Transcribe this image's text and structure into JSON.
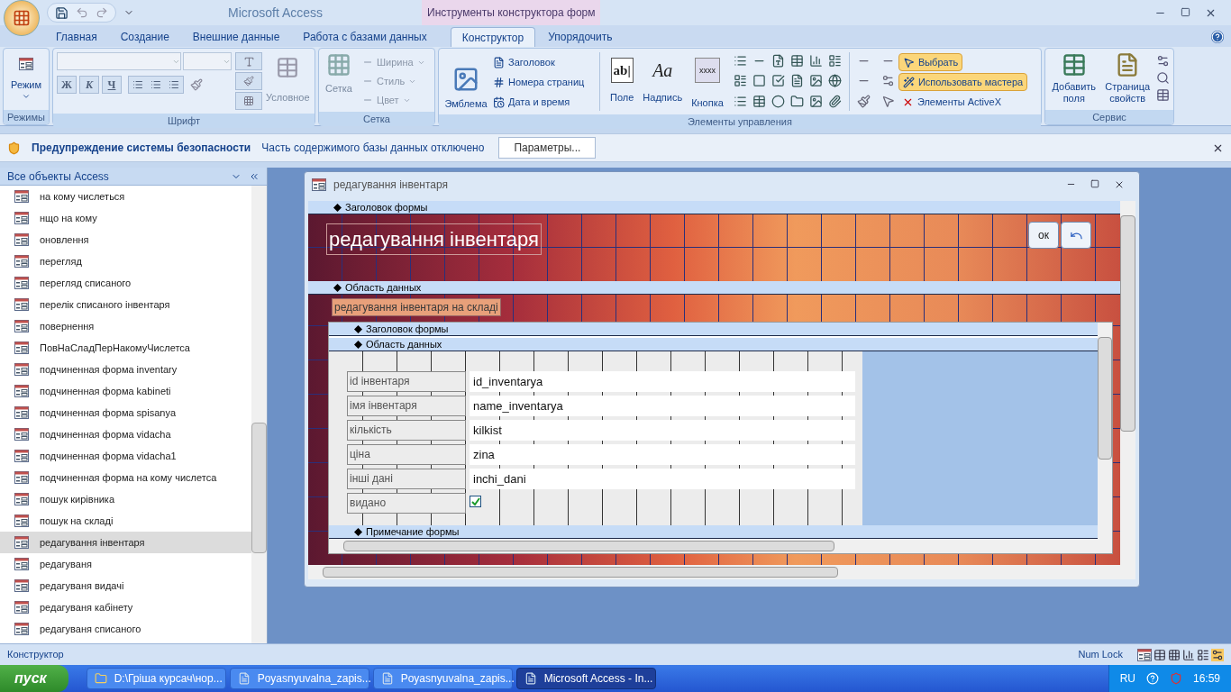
{
  "window": {
    "title": "Microsoft Access",
    "context_tab": "Инструменты конструктора форм"
  },
  "ribbon_tabs": [
    {
      "label": "Главная",
      "selected": false
    },
    {
      "label": "Создание",
      "selected": false
    },
    {
      "label": "Внешние данные",
      "selected": false
    },
    {
      "label": "Работа с базами данных",
      "selected": false
    },
    {
      "label": "Конструктор",
      "selected": true
    },
    {
      "label": "Упорядочить",
      "selected": false
    }
  ],
  "ribbon": {
    "modes": {
      "label": "Режимы",
      "button": "Режим"
    },
    "font": {
      "label": "Шрифт",
      "styles": [
        "Ж",
        "К",
        "Ч"
      ],
      "conditional": "Условное"
    },
    "grid": {
      "label": "Сетка",
      "button": "Сетка",
      "items": [
        "Ширина",
        "Стиль",
        "Цвет"
      ]
    },
    "controls": {
      "label": "Элементы управления",
      "logo": "Эмблема",
      "header_items": [
        "Заголовок",
        "Номера страниц",
        "Дата и время"
      ],
      "big_buttons": [
        {
          "label": "Поле",
          "glyph": "ab|"
        },
        {
          "label": "Надпись",
          "glyph": "Aa"
        },
        {
          "label": "Кнопка",
          "glyph": "xxxx"
        }
      ],
      "select": {
        "label": "Выбрать",
        "selected": true
      },
      "wizard": {
        "label": "Использовать мастера",
        "on": true
      },
      "activex": "Элементы ActiveX"
    },
    "service": {
      "label": "Сервис",
      "buttons": [
        "Добавить поля",
        "Страница свойств"
      ]
    }
  },
  "security_bar": {
    "title": "Предупреждение системы безопасности",
    "message": "Часть содержимого базы данных отключено",
    "button": "Параметры..."
  },
  "nav": {
    "title": "Все объекты Access",
    "items": [
      {
        "label": "на кому числеться",
        "selected": false
      },
      {
        "label": "нщо на кому",
        "selected": false
      },
      {
        "label": "оновлення",
        "selected": false
      },
      {
        "label": "перегляд",
        "selected": false
      },
      {
        "label": "перегляд списаного",
        "selected": false
      },
      {
        "label": "перелік списаного інвентаря",
        "selected": false
      },
      {
        "label": "повернення",
        "selected": false
      },
      {
        "label": "ПовНаСладПерНакомуЧислетса",
        "selected": false
      },
      {
        "label": "подчиненная форма inventary",
        "selected": false
      },
      {
        "label": "подчиненная форма kabineti",
        "selected": false
      },
      {
        "label": "подчиненная форма spisanya",
        "selected": false
      },
      {
        "label": "подчиненная форма vidacha",
        "selected": false
      },
      {
        "label": "подчиненная форма vidacha1",
        "selected": false
      },
      {
        "label": "подчиненная форма на кому числетса",
        "selected": false
      },
      {
        "label": "пошук кирівника",
        "selected": false
      },
      {
        "label": "пошук на складі",
        "selected": false
      },
      {
        "label": "редагування інвентаря",
        "selected": true
      },
      {
        "label": "редагуваня",
        "selected": false
      },
      {
        "label": "редагуваня видачі",
        "selected": false
      },
      {
        "label": "редагуваня кабінету",
        "selected": false
      },
      {
        "label": "редагуваня списаного",
        "selected": false
      }
    ]
  },
  "form_window": {
    "title": "редагування інвентаря",
    "header_section": "Заголовок формы",
    "detail_section": "Область данных",
    "heading": "редагування інвентаря",
    "ok_button": "ок",
    "detail_label": "редагування інвентаря на складі",
    "subform": {
      "header_section": "Заголовок формы",
      "detail_section": "Область данных",
      "footer_section": "Примечание формы",
      "fields": [
        {
          "label": "id інвентаря",
          "kind": "text",
          "value": "id_inventarya"
        },
        {
          "label": "імя інвентаря",
          "kind": "text",
          "value": "name_inventarya"
        },
        {
          "label": "кількість",
          "kind": "text",
          "value": "kilkist"
        },
        {
          "label": "ціна",
          "kind": "text",
          "value": "zina"
        },
        {
          "label": "інші дані",
          "kind": "text",
          "value": "inchi_dani"
        },
        {
          "label": "видано",
          "kind": "checkbox",
          "checked": true
        }
      ]
    }
  },
  "status_bar": {
    "mode": "Конструктор",
    "num_lock": "Num Lock"
  },
  "taskbar": {
    "start": "пуск",
    "tasks": [
      {
        "label": "D:\\Гріша курсач\\нор...",
        "selected": false
      },
      {
        "label": "Poyasnyuvalna_zapis...",
        "selected": false
      },
      {
        "label": "Poyasnyuvalna_zapis...",
        "selected": false
      },
      {
        "label": "Microsoft Access - In...",
        "selected": true
      }
    ],
    "lang": "RU",
    "clock": "16:59"
  }
}
